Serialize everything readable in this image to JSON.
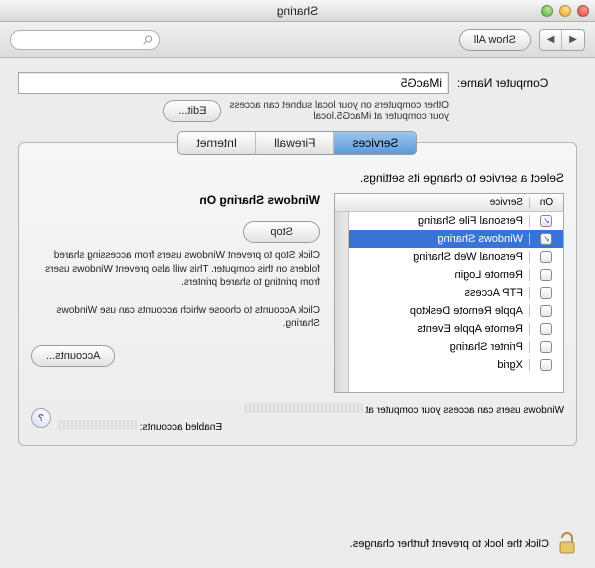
{
  "window": {
    "title": "Sharing"
  },
  "toolbar": {
    "show_all_label": "Show All",
    "search_placeholder": ""
  },
  "computer_name": {
    "label": "Computer Name:",
    "value": "iMacG5",
    "hint_line1": "Other computers on your local subnet can access",
    "hint_line2": "your computer at iMacG5.local",
    "edit_label": "Edit..."
  },
  "tabs": {
    "services": "Services",
    "firewall": "Firewall",
    "internet": "Internet",
    "active": "services"
  },
  "panel": {
    "heading": "Select a service to change its settings.",
    "columns": {
      "on": "On",
      "service": "Service"
    },
    "services": [
      {
        "on": true,
        "name": "Personal File Sharing",
        "selected": false
      },
      {
        "on": true,
        "name": "Windows Sharing",
        "selected": true
      },
      {
        "on": false,
        "name": "Personal Web Sharing",
        "selected": false
      },
      {
        "on": false,
        "name": "Remote Login",
        "selected": false
      },
      {
        "on": false,
        "name": "FTP Access",
        "selected": false
      },
      {
        "on": false,
        "name": "Apple Remote Desktop",
        "selected": false
      },
      {
        "on": false,
        "name": "Remote Apple Events",
        "selected": false
      },
      {
        "on": false,
        "name": "Printer Sharing",
        "selected": false
      },
      {
        "on": false,
        "name": "Xgrid",
        "selected": false
      }
    ],
    "detail": {
      "title": "Windows Sharing On",
      "stop_label": "Stop",
      "stop_help": "Click Stop to prevent Windows users from accessing shared folders on this computer. This will also prevent Windows users from printing to shared printers.",
      "accounts_help": "Click Accounts to choose which accounts can use Windows Sharing.",
      "accounts_label": "Accounts..."
    },
    "footer": {
      "access_text": "Windows users can access your computer at",
      "enabled_text": "Enabled accounts:"
    }
  },
  "lock": {
    "text": "Click the lock to prevent further changes."
  }
}
